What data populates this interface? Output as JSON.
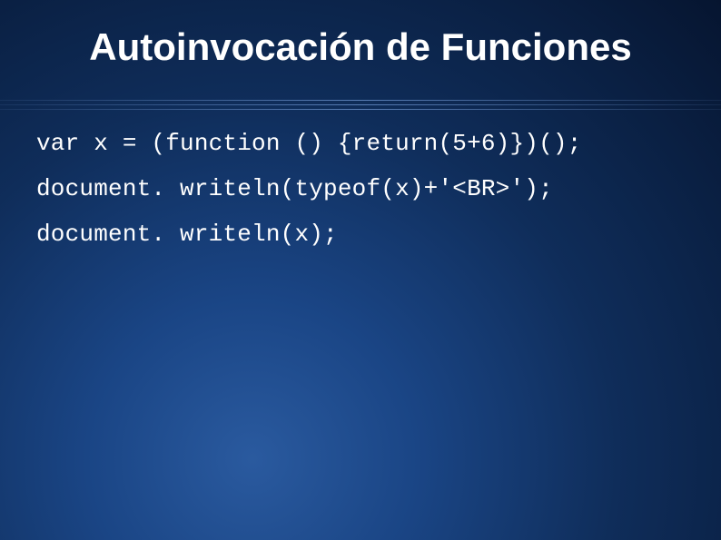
{
  "title": "Autoinvocación de Funciones",
  "code": {
    "line1": "var x = (function () {return(5+6)})();",
    "line2": "document. writeln(typeof(x)+'<BR>');",
    "line3": "document. writeln(x);"
  }
}
